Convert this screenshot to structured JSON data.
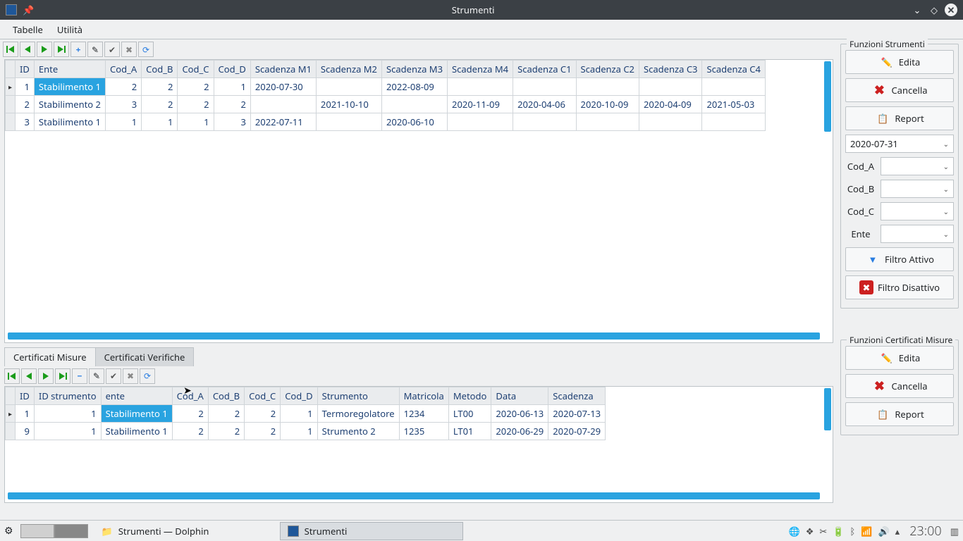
{
  "window": {
    "title": "Strumenti"
  },
  "menu": {
    "tabelle": "Tabelle",
    "utilita": "Utilità"
  },
  "top_table": {
    "headers": [
      "ID",
      "Ente",
      "Cod_A",
      "Cod_B",
      "Cod_C",
      "Cod_D",
      "Scadenza M1",
      "Scadenza M2",
      "Scadenza M3",
      "Scadenza M4",
      "Scadenza C1",
      "Scadenza C2",
      "Scadenza C3",
      "Scadenza C4"
    ],
    "rows": [
      {
        "id": "1",
        "ente": "Stabilimento 1",
        "ca": "2",
        "cb": "2",
        "cc": "2",
        "cd": "1",
        "m1": "2020-07-30",
        "m2": "",
        "m3": "2022-08-09",
        "m4": "",
        "c1": "",
        "c2": "",
        "c3": "",
        "c4": ""
      },
      {
        "id": "2",
        "ente": "Stabilimento 2",
        "ca": "3",
        "cb": "2",
        "cc": "2",
        "cd": "2",
        "m1": "",
        "m2": "2021-10-10",
        "m3": "",
        "m4": "2020-11-09",
        "c1": "2020-04-06",
        "c2": "2020-10-09",
        "c3": "2020-04-09",
        "c4": "2021-05-03"
      },
      {
        "id": "3",
        "ente": "Stabilimento 1",
        "ca": "1",
        "cb": "1",
        "cc": "1",
        "cd": "3",
        "m1": "2022-07-11",
        "m2": "",
        "m3": "2020-06-10",
        "m4": "",
        "c1": "",
        "c2": "",
        "c3": "",
        "c4": ""
      }
    ]
  },
  "tabs": {
    "misure": "Certificati Misure",
    "verifiche": "Certificati Verifiche"
  },
  "bottom_table": {
    "headers": [
      "ID",
      "ID strumento",
      "ente",
      "Cod_A",
      "Cod_B",
      "Cod_C",
      "Cod_D",
      "Strumento",
      "Matricola",
      "Metodo",
      "Data",
      "Scadenza"
    ],
    "rows": [
      {
        "id": "1",
        "idstr": "1",
        "ente": "Stabilimento 1",
        "ca": "2",
        "cb": "2",
        "cc": "2",
        "cd": "1",
        "strum": "Termoregolatore",
        "matr": "1234",
        "met": "LT00",
        "data": "2020-06-13",
        "scad": "2020-07-13"
      },
      {
        "id": "9",
        "idstr": "1",
        "ente": "Stabilimento 1",
        "ca": "2",
        "cb": "2",
        "cc": "2",
        "cd": "1",
        "strum": "Strumento 2",
        "matr": "1235",
        "met": "LT01",
        "data": "2020-06-29",
        "scad": "2020-07-29"
      }
    ]
  },
  "sidebar": {
    "group1_title": "Funzioni Strumenti",
    "group2_title": "Funzioni Certificati Misure",
    "edita": "Edita",
    "cancella": "Cancella",
    "report": "Report",
    "date": "2020-07-31",
    "filters": {
      "a": "Cod_A",
      "b": "Cod_B",
      "c": "Cod_C",
      "ente": "Ente"
    },
    "filtro_attivo": "Filtro Attivo",
    "filtro_disattivo": "Filtro Disattivo"
  },
  "taskbar": {
    "task1": "Strumenti — Dolphin",
    "task2": "Strumenti",
    "clock": "23:00"
  }
}
